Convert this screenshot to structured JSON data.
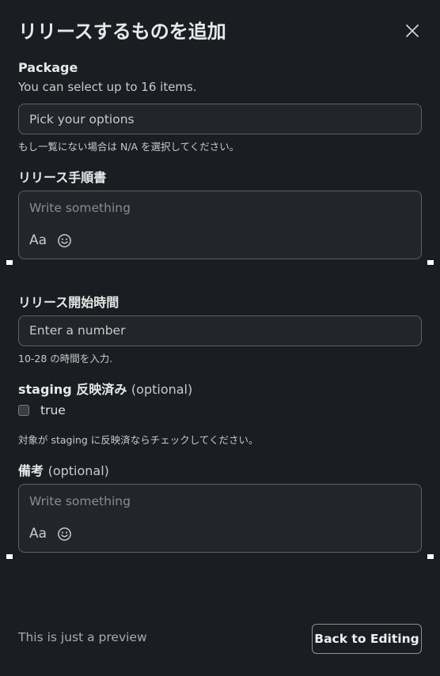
{
  "modal": {
    "title": "リリースするものを追加",
    "close_icon": "close-icon"
  },
  "package": {
    "label": "Package",
    "hint": "You can select up to 16 items.",
    "placeholder": "Pick your options",
    "note": "もし一覧にない場合は N/A を選択してください。"
  },
  "procedure": {
    "label": "リリース手順書",
    "placeholder": "Write something",
    "format_label": "Aa",
    "emoji_icon": "emoji-icon"
  },
  "start_time": {
    "label": "リリース開始時間",
    "placeholder": "Enter a number",
    "note": "10-28 の時間を入力."
  },
  "staging": {
    "label": "staging 反映済み",
    "optional": "(optional)",
    "checkbox_label": "true",
    "checked": false,
    "note": "対象が staging に反映済ならチェックしてください。"
  },
  "remarks": {
    "label": "備考",
    "optional": "(optional)",
    "placeholder": "Write something",
    "format_label": "Aa",
    "emoji_icon": "emoji-icon"
  },
  "footer": {
    "preview_text": "This is just a preview",
    "back_button": "Back to Editing"
  }
}
